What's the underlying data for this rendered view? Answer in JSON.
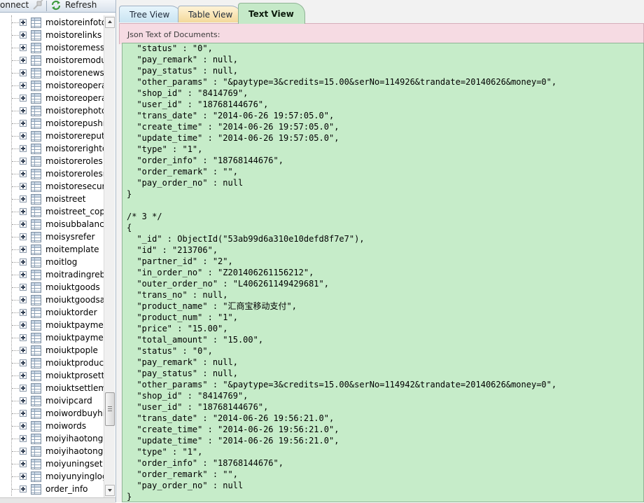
{
  "toolbar": {
    "connect_label": "onnect",
    "refresh_label": "Refresh"
  },
  "tree": {
    "items": [
      "moistoreinfotow",
      "moistorelinks",
      "moistoremessa",
      "moistoremodul",
      "moistorenews",
      "moistoreoperat",
      "moistoreoperat",
      "moistorephoto",
      "moistorepushn",
      "moistorereputa",
      "moistorerightco",
      "moistoreroles",
      "moistorerolesrig",
      "moistoresecurit",
      "moistreet",
      "moistreet_copy",
      "moisubbalance",
      "moisysrefer",
      "moitemplate",
      "moitlog",
      "moitradingreba",
      "moiuktgoods",
      "moiuktgoodsat",
      "moiuktorder",
      "moiuktpaymen",
      "moiuktpaymen",
      "moiuktpople",
      "moiuktproduct",
      "moiuktprosettle",
      "moiuktsettleme",
      "moivipcard",
      "moiwordbuyhis",
      "moiwords",
      "moiyihaotong",
      "moiyihaotongre",
      "moiyuningset",
      "moiyunyinglog",
      "order_info"
    ]
  },
  "tabs": {
    "tree_view": "Tree View",
    "table_view": "Table View",
    "text_view": "Text View"
  },
  "content_label": "Json Text of Documents:",
  "json_lines": [
    "  \"status\" : \"0\",",
    "  \"pay_remark\" : null,",
    "  \"pay_status\" : null,",
    "  \"other_params\" : \"&paytype=3&credits=15.00&serNo=114926&trandate=20140626&money=0\",",
    "  \"shop_id\" : \"8414769\",",
    "  \"user_id\" : \"18768144676\",",
    "  \"trans_date\" : \"2014-06-26 19:57:05.0\",",
    "  \"create_time\" : \"2014-06-26 19:57:05.0\",",
    "  \"update_time\" : \"2014-06-26 19:57:05.0\",",
    "  \"type\" : \"1\",",
    "  \"order_info\" : \"18768144676\",",
    "  \"order_remark\" : \"\",",
    "  \"pay_order_no\" : null",
    "}",
    "",
    "/* 3 */",
    "{",
    "  \"_id\" : ObjectId(\"53ab99d6a310e10defd8f7e7\"),",
    "  \"id\" : \"213706\",",
    "  \"partner_id\" : \"2\",",
    "  \"in_order_no\" : \"Z201406261156212\",",
    "  \"outer_order_no\" : \"L406261149429681\",",
    "  \"trans_no\" : null,",
    "  \"product_name\" : \"汇商宝移动支付\",",
    "  \"product_num\" : \"1\",",
    "  \"price\" : \"15.00\",",
    "  \"total_amount\" : \"15.00\",",
    "  \"status\" : \"0\",",
    "  \"pay_remark\" : null,",
    "  \"pay_status\" : null,",
    "  \"other_params\" : \"&paytype=3&credits=15.00&serNo=114942&trandate=20140626&money=0\",",
    "  \"shop_id\" : \"8414769\",",
    "  \"user_id\" : \"18768144676\",",
    "  \"trans_date\" : \"2014-06-26 19:56:21.0\",",
    "  \"create_time\" : \"2014-06-26 19:56:21.0\",",
    "  \"update_time\" : \"2014-06-26 19:56:21.0\",",
    "  \"type\" : \"1\",",
    "  \"order_info\" : \"18768144676\",",
    "  \"order_remark\" : \"\",",
    "  \"pay_order_no\" : null",
    "}"
  ]
}
